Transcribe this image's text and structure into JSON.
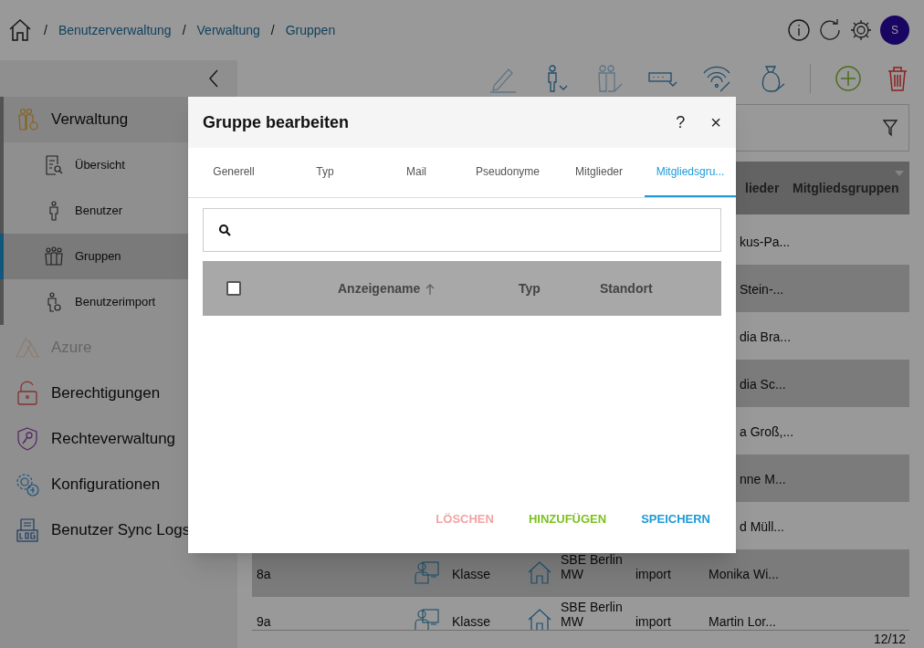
{
  "breadcrumb": [
    {
      "separator": "/",
      "label": "Benutzerverwaltung"
    },
    {
      "separator": "/",
      "label": "Verwaltung"
    },
    {
      "separator": "/",
      "label": "Gruppen"
    }
  ],
  "user": {
    "initial": "S"
  },
  "sidebar": {
    "items": [
      {
        "label": "Verwaltung",
        "expanded": true,
        "disabled": false,
        "children": [
          {
            "label": "Übersicht",
            "selected": false
          },
          {
            "label": "Benutzer",
            "selected": false
          },
          {
            "label": "Gruppen",
            "selected": true
          },
          {
            "label": "Benutzerimport",
            "selected": false
          }
        ]
      },
      {
        "label": "Azure",
        "expanded": false,
        "disabled": true
      },
      {
        "label": "Berechtigungen",
        "expanded": false,
        "disabled": false
      },
      {
        "label": "Rechteverwaltung",
        "expanded": false,
        "disabled": false
      },
      {
        "label": "Konfigurationen",
        "expanded": false,
        "disabled": false
      },
      {
        "label": "Benutzer Sync Logs",
        "expanded": false,
        "disabled": false
      }
    ]
  },
  "table": {
    "columns": [
      "lieder",
      "Mitgliedsgruppen"
    ],
    "rows": [
      {
        "kind": "partial",
        "members": "kus-Pa..."
      },
      {
        "kind": "partial",
        "members": "Stein-..."
      },
      {
        "kind": "partial",
        "members": "dia Bra..."
      },
      {
        "kind": "partial",
        "members": "dia Sc..."
      },
      {
        "kind": "partial",
        "members": "a Groß,..."
      },
      {
        "kind": "partial",
        "members": "nne M..."
      },
      {
        "kind": "partial",
        "members": "d Müll..."
      },
      {
        "kind": "full",
        "name": "8a",
        "type": "Klasse",
        "location": "SBE Berlin MW",
        "source": "import",
        "members": "Monika Wi..."
      },
      {
        "kind": "full",
        "name": "9a",
        "type": "Klasse",
        "location": "SBE Berlin MW",
        "source": "import",
        "members": "Martin Lor..."
      }
    ],
    "pagination": "12/12"
  },
  "dialog": {
    "title": "Gruppe bearbeiten",
    "help": "?",
    "close": "×",
    "tabs": [
      {
        "label": "Generell",
        "selected": false
      },
      {
        "label": "Typ",
        "selected": false
      },
      {
        "label": "Mail",
        "selected": false
      },
      {
        "label": "Pseudonyme",
        "selected": false
      },
      {
        "label": "Mitglieder",
        "selected": false
      },
      {
        "label": "Mitgliedsgru...",
        "selected": true
      }
    ],
    "select_all": {
      "checked": false
    },
    "columns": [
      {
        "label": "Anzeigename",
        "sorted": true
      },
      {
        "label": "Typ",
        "sorted": false
      },
      {
        "label": "Standort",
        "sorted": false
      }
    ],
    "buttons": [
      {
        "label": "LÖSCHEN",
        "kind": "danger",
        "disabled": true
      },
      {
        "label": "HINZUFÜGEN",
        "kind": "add",
        "disabled": false
      },
      {
        "label": "SPEICHERN",
        "kind": "save",
        "disabled": false
      }
    ]
  }
}
